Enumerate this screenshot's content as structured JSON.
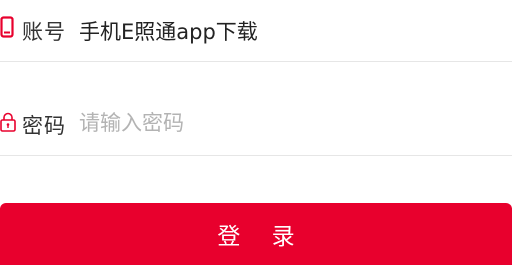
{
  "account": {
    "label": "账号",
    "value": "手机E照通app下载",
    "icon": "phone-icon"
  },
  "password": {
    "label": "密码",
    "placeholder": "请输入密码",
    "value": "",
    "icon": "lock-icon"
  },
  "login_button": {
    "label": "登 录"
  },
  "colors": {
    "accent": "#e8002d",
    "placeholder": "#b3b3b3",
    "divider": "#e6e6e6"
  }
}
